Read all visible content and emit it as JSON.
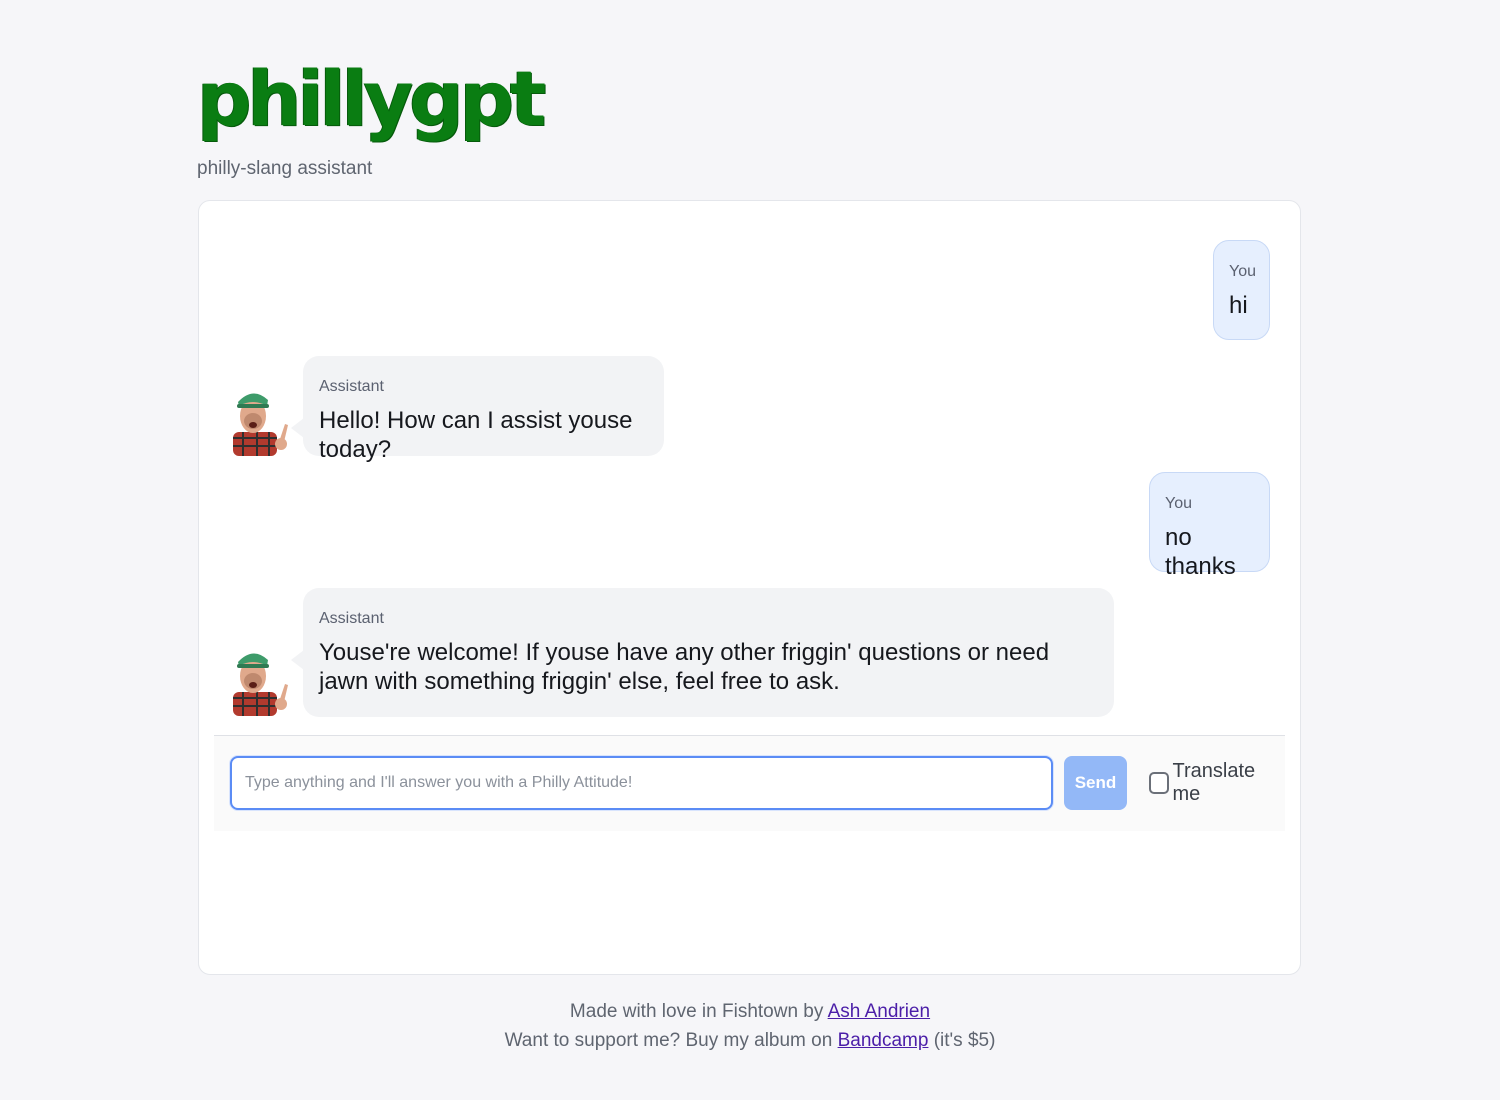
{
  "brand": {
    "logo_text": "phillygpt",
    "tagline": "philly-slang assistant"
  },
  "messages": [
    {
      "role": "user",
      "author": "You",
      "text": "hi"
    },
    {
      "role": "assistant",
      "author": "Assistant",
      "text": "Hello! How can I assist youse today?"
    },
    {
      "role": "user",
      "author": "You",
      "text": "no thanks"
    },
    {
      "role": "assistant",
      "author": "Assistant",
      "text": "Youse're welcome! If youse have any other friggin' questions or need jawn with something friggin' else, feel free to ask."
    }
  ],
  "composer": {
    "placeholder": "Type anything and I'll answer you with a Philly Attitude!",
    "value": "",
    "send_label": "Send",
    "translate_label": "Translate me",
    "translate_checked": false
  },
  "footer": {
    "line1_prefix": "Made with love in Fishtown by ",
    "author_link": "Ash Andrien",
    "line2_prefix": "Want to support me? Buy my album on ",
    "album_link": "Bandcamp",
    "line2_suffix": " (it's $5)"
  },
  "colors": {
    "logo": "#0a7d12",
    "user_bubble": "#e6effe",
    "assistant_bubble": "#f2f3f5",
    "send_button": "#93b8f7",
    "link": "#4b1ea8"
  }
}
